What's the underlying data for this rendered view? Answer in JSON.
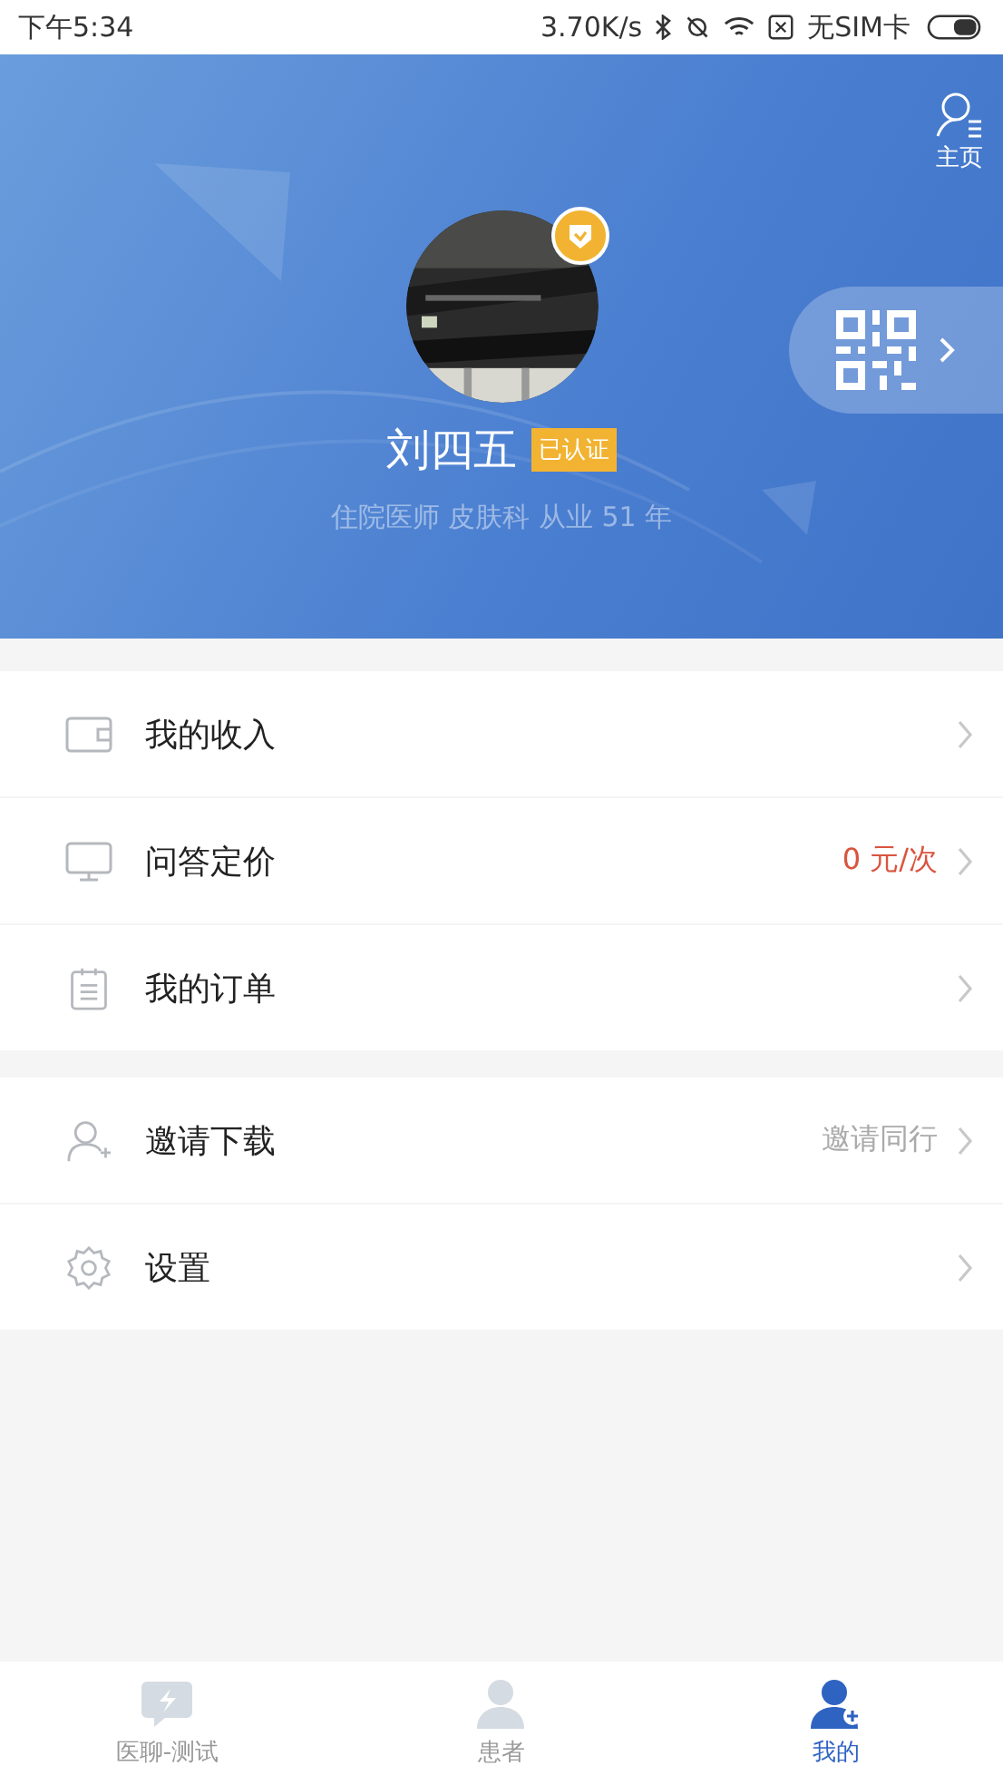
{
  "status_bar": {
    "time": "下午5:34",
    "speed": "3.70K/s",
    "sim": "无SIM卡"
  },
  "header": {
    "home_label": "主页",
    "name": "刘四五",
    "verified_badge": "已认证",
    "subtitle": "住院医师 皮肤科 从业 51 年"
  },
  "menu_groups": [
    {
      "items": [
        {
          "kind": "wallet",
          "label": "我的收入"
        },
        {
          "kind": "monitor",
          "label": "问答定价",
          "value": {
            "text": "0 元/次",
            "color": "#d9553f"
          }
        },
        {
          "kind": "clipboard",
          "label": "我的订单"
        }
      ]
    },
    {
      "items": [
        {
          "kind": "invite",
          "label": "邀请下载",
          "value": {
            "text": "邀请同行",
            "color": "#aaaaaa"
          }
        },
        {
          "kind": "settings",
          "label": "设置"
        }
      ]
    }
  ],
  "tab_bar": [
    {
      "kind": "chat",
      "label": "医聊-测试",
      "selected": false
    },
    {
      "kind": "patients",
      "label": "患者",
      "selected": false
    },
    {
      "kind": "mine",
      "label": "我的",
      "selected": true
    }
  ]
}
